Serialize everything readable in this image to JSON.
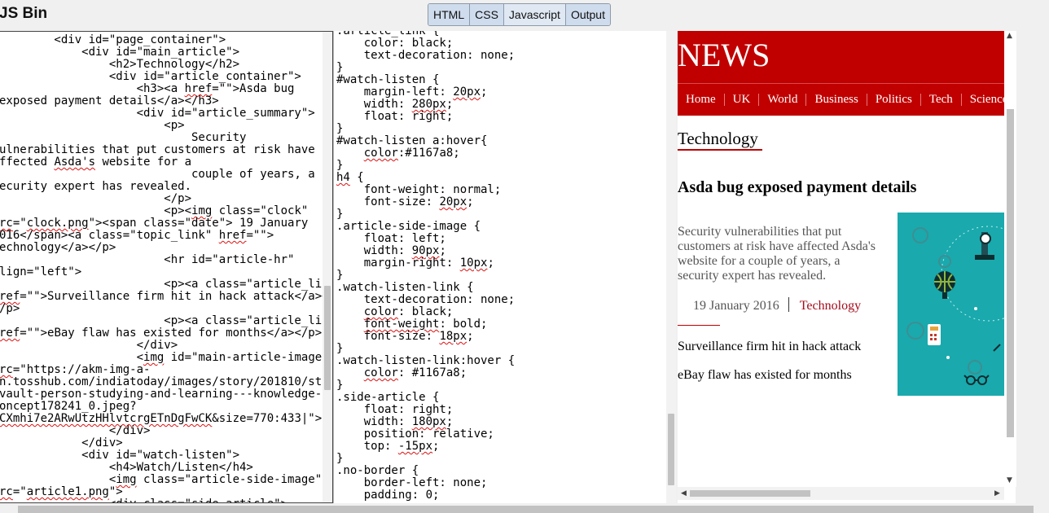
{
  "app": {
    "title": "JS Bin"
  },
  "panel_toggles": [
    "HTML",
    "CSS",
    "Javascript",
    "Output"
  ],
  "html_editor": {
    "lines": [
      [
        [
          "        <div id=\"page_container\">"
        ]
      ],
      [
        [
          "            <div id=\"main_article\">"
        ]
      ],
      [
        [
          "                <h2>Technology</h2>"
        ]
      ],
      [
        [
          "                <div id=\"article_container\">"
        ]
      ],
      [
        [
          "                    <h3><a "
        ],
        [
          "href",
          "u"
        ],
        [
          "=\"\">Asda bug"
        ]
      ],
      [
        [
          "exposed payment details</a></h3>"
        ]
      ],
      [
        [
          "                    <div id=\"article_summary\">"
        ]
      ],
      [
        [
          "                        <p>"
        ]
      ],
      [
        [
          "                            Security"
        ]
      ],
      [
        [
          "ulnerabilities that put customers at risk have"
        ]
      ],
      [
        [
          "ffected "
        ],
        [
          "Asda's",
          "u"
        ],
        [
          " website for a"
        ]
      ],
      [
        [
          "                            couple of years, a"
        ]
      ],
      [
        [
          "ecurity expert has revealed."
        ]
      ],
      [
        [
          "                        </p>"
        ]
      ],
      [
        [
          "                        <p><"
        ],
        [
          "img",
          "u"
        ],
        [
          " class=\"clock\""
        ]
      ],
      [
        [
          "rc",
          "u"
        ],
        [
          "=\""
        ],
        [
          "clock.png",
          "u"
        ],
        [
          "\"><span class=\"date\"> 19 January"
        ]
      ],
      [
        [
          "016</span><a class=\"topic_link\" "
        ],
        [
          "href",
          "u"
        ],
        [
          "=\"\">"
        ]
      ],
      [
        [
          "echnology</a></p>"
        ]
      ],
      [
        [
          "                        <hr id=\"article-hr\""
        ]
      ],
      [
        [
          "lign=\"left\">"
        ]
      ],
      [
        [
          "                        <p><a class=\"article_link\""
        ]
      ],
      [
        [
          "ref",
          "u"
        ],
        [
          "=\"\">Surveillance firm hit in hack attack</a><"
        ]
      ],
      [
        [
          "/p>"
        ]
      ],
      [
        [
          "                        <p><a class=\"article_link\""
        ]
      ],
      [
        [
          "ref",
          "u"
        ],
        [
          "=\"\">eBay flaw has existed for months</a></p>"
        ]
      ],
      [
        [
          "                    </div>"
        ]
      ],
      [
        [
          "                    <"
        ],
        [
          "img",
          "u"
        ],
        [
          " id=\"main-article-image\""
        ]
      ],
      [
        [
          "rc",
          "u"
        ],
        [
          "=\"https://akm-img-a-"
        ]
      ],
      [
        [
          "n.tosshub.com/indiatoday/images/story/201810/stoc"
        ]
      ],
      [
        [
          "vault-person-studying-and-learning---knowledge-"
        ]
      ],
      [
        [
          "oncept178241_0.jpeg?"
        ]
      ],
      [
        [
          "CXmhi7e2ARwUtzHHlvtcrgETnDgFwCK",
          "u"
        ],
        [
          "&size=770:433|\">"
        ]
      ],
      [
        [
          "                </div>"
        ]
      ],
      [
        [
          "            </div>"
        ]
      ],
      [
        [
          "            <div id=\"watch-listen\">"
        ]
      ],
      [
        [
          "                <h4>Watch/Listen</h4>"
        ]
      ],
      [
        [
          "                <"
        ],
        [
          "img",
          "u"
        ],
        [
          " class=\"article-side-image\""
        ]
      ],
      [
        [
          "rc",
          "u"
        ],
        [
          "=\""
        ],
        [
          "article1.png",
          "u"
        ],
        [
          "\">"
        ]
      ],
      [
        [
          "                <div class=\"side-article\">"
        ]
      ]
    ]
  },
  "css_editor": {
    "lines": [
      [
        [
          ".article_link {"
        ]
      ],
      [
        [
          "    color: black;"
        ]
      ],
      [
        [
          "    text-decoration: none;"
        ]
      ],
      [
        [
          "}"
        ]
      ],
      [
        [
          "#watch-listen {"
        ]
      ],
      [
        [
          "    margin-left: "
        ],
        [
          "20px",
          "u"
        ],
        [
          ";"
        ]
      ],
      [
        [
          "    width: "
        ],
        [
          "280px",
          "u"
        ],
        [
          ";"
        ]
      ],
      [
        [
          "    float: right;"
        ]
      ],
      [
        [
          "}"
        ]
      ],
      [
        [
          "#watch-listen a:hover{"
        ]
      ],
      [
        [
          "    "
        ],
        [
          "color",
          "u"
        ],
        [
          ":#1167a8;"
        ]
      ],
      [
        [
          "}"
        ]
      ],
      [
        [
          "h4",
          "u"
        ],
        [
          " {"
        ]
      ],
      [
        [
          "    font-weight: normal;"
        ]
      ],
      [
        [
          "    font-size: "
        ],
        [
          "20px",
          "u"
        ],
        [
          ";"
        ]
      ],
      [
        [
          "}"
        ]
      ],
      [
        [
          ".article-side-image {"
        ]
      ],
      [
        [
          "    float: left;"
        ]
      ],
      [
        [
          "    width: "
        ],
        [
          "90px",
          "u"
        ],
        [
          ";"
        ]
      ],
      [
        [
          "    margin-right: "
        ],
        [
          "10px",
          "u"
        ],
        [
          ";"
        ]
      ],
      [
        [
          "}"
        ]
      ],
      [
        [
          ".watch-listen-link {"
        ]
      ],
      [
        [
          "    text-decoration: none;"
        ]
      ],
      [
        [
          "    "
        ],
        [
          "color",
          "u"
        ],
        [
          ": black;"
        ]
      ],
      [
        [
          "    "
        ],
        [
          "font-weight",
          "u"
        ],
        [
          ": bold;"
        ]
      ],
      [
        [
          "    font-size: "
        ],
        [
          "18px",
          "u"
        ],
        [
          ";"
        ]
      ],
      [
        [
          "}"
        ]
      ],
      [
        [
          ".watch-listen-link:hover {"
        ]
      ],
      [
        [
          "    "
        ],
        [
          "color",
          "u"
        ],
        [
          ": #1167a8;"
        ]
      ],
      [
        [
          "}"
        ]
      ],
      [
        [
          ".side-article {"
        ]
      ],
      [
        [
          "    float: right;"
        ]
      ],
      [
        [
          "    width: "
        ],
        [
          "180px",
          "u"
        ],
        [
          ";"
        ]
      ],
      [
        [
          "    position: relative;"
        ]
      ],
      [
        [
          "    top: "
        ],
        [
          "-15px",
          "u"
        ],
        [
          ";"
        ]
      ],
      [
        [
          "}"
        ]
      ],
      [
        [
          ".no-border {"
        ]
      ],
      [
        [
          "    border-left: none;"
        ]
      ],
      [
        [
          "    padding: 0;"
        ]
      ]
    ]
  },
  "output": {
    "logo": "NEWS",
    "nav": [
      "Home",
      "UK",
      "World",
      "Business",
      "Politics",
      "Tech",
      "Science"
    ],
    "section_heading": "Technology",
    "article_title": "Asda bug exposed payment details",
    "summary": "Security vulnerabilities that put customers at risk have affected Asda's website for a couple of years, a security expert has revealed.",
    "date": "19 January 2016",
    "topic": "Technology",
    "links": [
      "Surveillance firm hit in hack attack",
      "eBay flaw has existed for months"
    ]
  },
  "colors": {
    "header_red": "#c00000",
    "topic_link": "#a50b1a",
    "image_teal": "#1aa9ad",
    "squiggle": "#dd1111"
  },
  "icons": {
    "image_illustration": "person-studying-knowledge-concept",
    "scrollbar_arrows": [
      "arrow-up-icon",
      "arrow-down-icon",
      "arrow-left-icon",
      "arrow-right-icon"
    ]
  }
}
